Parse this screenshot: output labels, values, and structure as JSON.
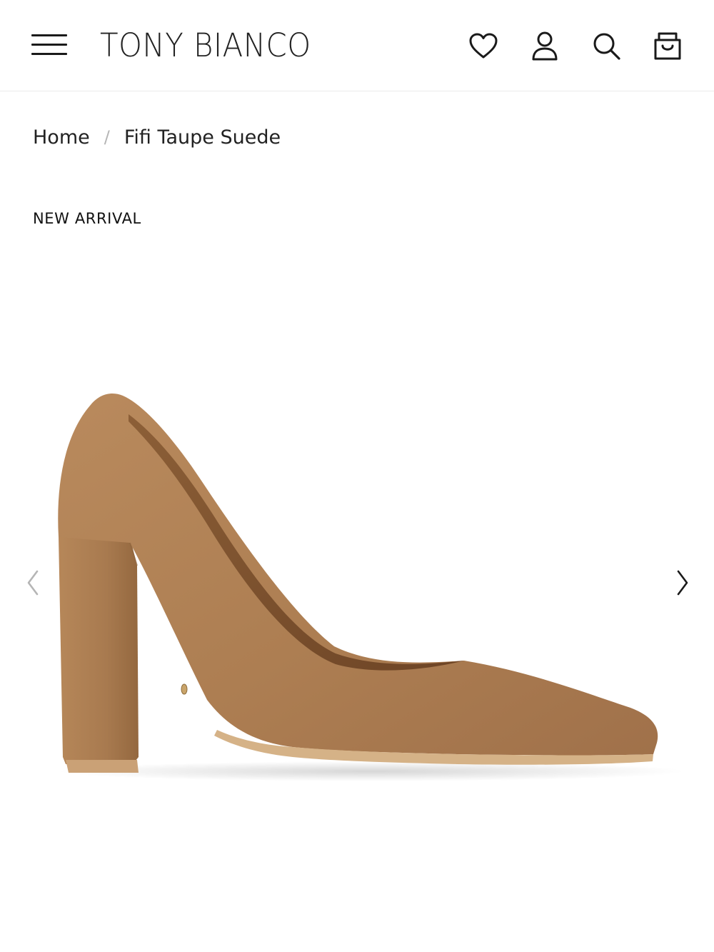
{
  "header": {
    "brand": "TONY BIANCO",
    "icons": [
      "menu-icon",
      "heart-icon",
      "user-icon",
      "search-icon",
      "shopping-bag-icon"
    ]
  },
  "breadcrumb": {
    "home": "Home",
    "separator": "/",
    "current": "Fifi Taupe Suede"
  },
  "product": {
    "badge": "NEW ARRIVAL",
    "color": "#b07f53"
  },
  "gallery": {
    "prev_icon": "chevron-left-icon",
    "next_icon": "chevron-right-icon"
  }
}
